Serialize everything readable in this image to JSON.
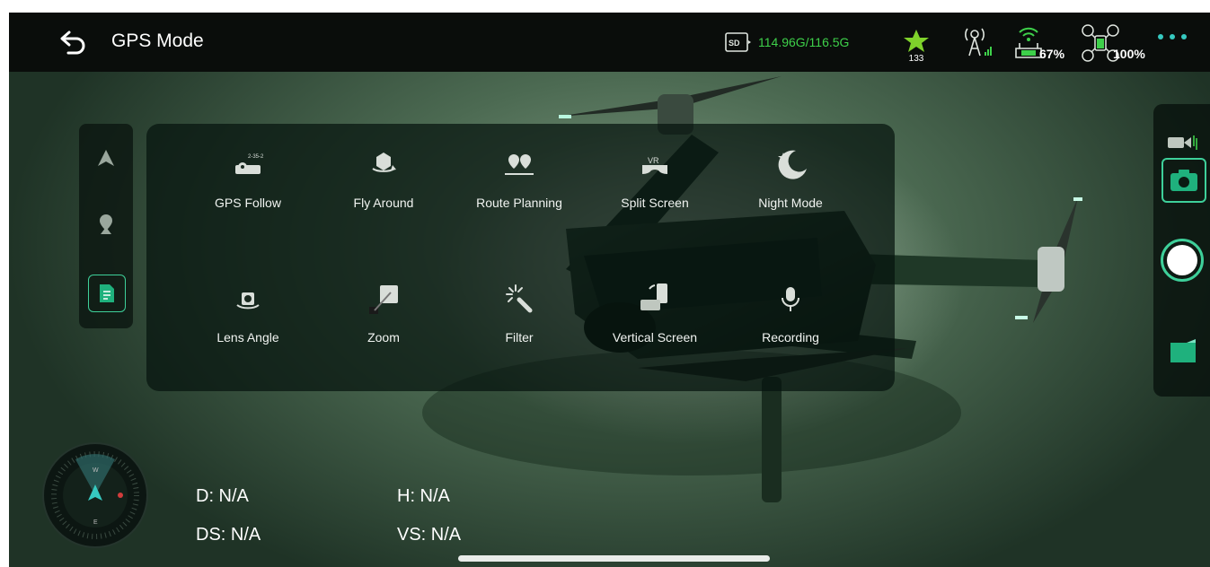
{
  "header": {
    "title": "GPS Mode",
    "storage": "114.96G/116.5G",
    "satellite_count": "133",
    "remote_battery": "67%",
    "drone_battery": "100%"
  },
  "side_tabs": [
    {
      "icon": "aircraft-icon"
    },
    {
      "icon": "location-pin-icon"
    },
    {
      "icon": "document-icon"
    }
  ],
  "functions": [
    {
      "label": "GPS Follow",
      "icon": "gps-follow-icon"
    },
    {
      "label": "Fly Around",
      "icon": "fly-around-icon"
    },
    {
      "label": "Route Planning",
      "icon": "route-planning-icon"
    },
    {
      "label": "Split Screen",
      "icon": "vr-split-screen-icon"
    },
    {
      "label": "Night Mode",
      "icon": "night-mode-icon"
    },
    {
      "label": "Lens Angle",
      "icon": "lens-angle-icon"
    },
    {
      "label": "Zoom",
      "icon": "zoom-icon"
    },
    {
      "label": "Filter",
      "icon": "filter-wand-icon"
    },
    {
      "label": "Vertical Screen",
      "icon": "vertical-screen-icon"
    },
    {
      "label": "Recording",
      "icon": "microphone-icon"
    }
  ],
  "telemetry": {
    "d": "D: N/A",
    "h": "H: N/A",
    "ds": "DS: N/A",
    "vs": "VS: N/A"
  },
  "colors": {
    "accent": "#3ed04a",
    "teal": "#36c9c0",
    "panel_bg": "#06140e"
  }
}
